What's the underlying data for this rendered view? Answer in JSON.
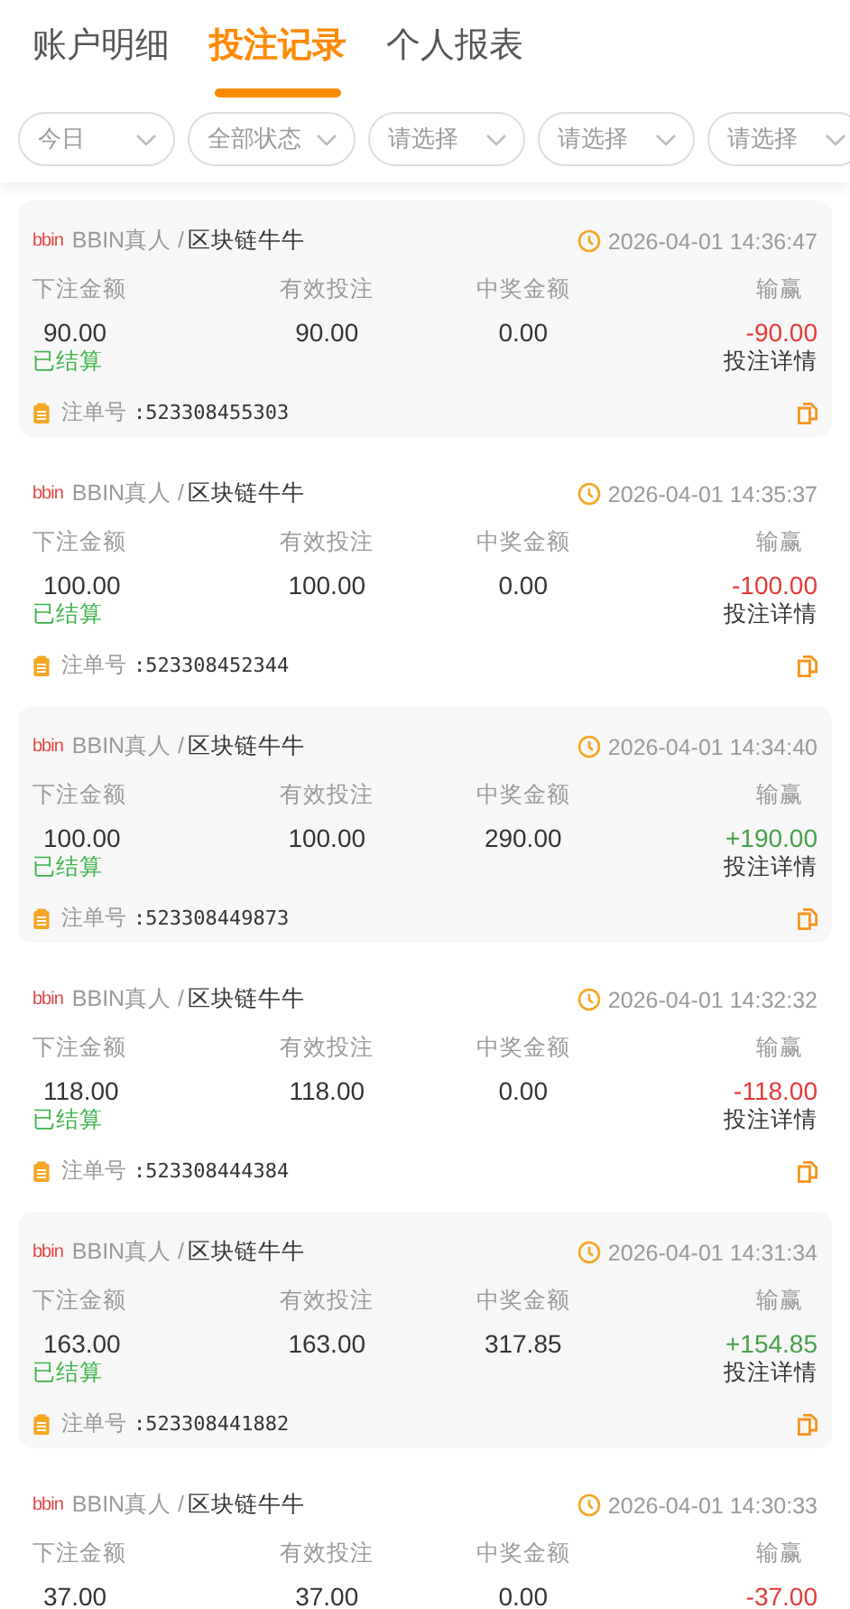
{
  "tabs": [
    {
      "label": "账户明细",
      "selected": false
    },
    {
      "label": "投注记录",
      "selected": true
    },
    {
      "label": "个人报表",
      "selected": false
    }
  ],
  "filters": [
    {
      "label": "今日"
    },
    {
      "label": "全部状态"
    },
    {
      "label": "请选择"
    },
    {
      "label": "请选择"
    },
    {
      "label": "请选择"
    }
  ],
  "records": [
    {
      "logo": "bbin",
      "platform": "BBIN真人 /",
      "game": "区块链牛牛",
      "time": "2026-04-01 14:36:47",
      "labels": [
        "下注金额",
        "有效投注",
        "中奖金额",
        "输赢"
      ],
      "values": [
        "90.00",
        "90.00",
        "0.00",
        "-90.00"
      ],
      "color": "#e53935",
      "status": "已结算",
      "detail_link": "投注详情",
      "order_label": "注单号",
      "order_no": ":523308455303"
    },
    {
      "logo": "bbin",
      "platform": "BBIN真人 /",
      "game": "区块链牛牛",
      "time": "2026-04-01 14:35:37",
      "labels": [
        "下注金额",
        "有效投注",
        "中奖金额",
        "输赢"
      ],
      "values": [
        "100.00",
        "100.00",
        "0.00",
        "-100.00"
      ],
      "color": "#e53935",
      "status": "已结算",
      "detail_link": "投注详情",
      "order_label": "注单号",
      "order_no": ":523308452344"
    },
    {
      "logo": "bbin",
      "platform": "BBIN真人 /",
      "game": "区块链牛牛",
      "time": "2026-04-01 14:34:40",
      "labels": [
        "下注金额",
        "有效投注",
        "中奖金额",
        "输赢"
      ],
      "values": [
        "100.00",
        "100.00",
        "290.00",
        "+190.00"
      ],
      "color": "#43a047",
      "status": "已结算",
      "detail_link": "投注详情",
      "order_label": "注单号",
      "order_no": ":523308449873"
    },
    {
      "logo": "bbin",
      "platform": "BBIN真人 /",
      "game": "区块链牛牛",
      "time": "2026-04-01 14:32:32",
      "labels": [
        "下注金额",
        "有效投注",
        "中奖金额",
        "输赢"
      ],
      "values": [
        "118.00",
        "118.00",
        "0.00",
        "-118.00"
      ],
      "color": "#e53935",
      "status": "已结算",
      "detail_link": "投注详情",
      "order_label": "注单号",
      "order_no": ":523308444384"
    },
    {
      "logo": "bbin",
      "platform": "BBIN真人 /",
      "game": "区块链牛牛",
      "time": "2026-04-01 14:31:34",
      "labels": [
        "下注金额",
        "有效投注",
        "中奖金额",
        "输赢"
      ],
      "values": [
        "163.00",
        "163.00",
        "317.85",
        "+154.85"
      ],
      "color": "#43a047",
      "status": "已结算",
      "detail_link": "投注详情",
      "order_label": "注单号",
      "order_no": ":523308441882"
    },
    {
      "logo": "bbin",
      "platform": "BBIN真人 /",
      "game": "区块链牛牛",
      "time": "2026-04-01 14:30:33",
      "labels": [
        "下注金额",
        "有效投注",
        "中奖金额",
        "输赢"
      ],
      "values": [
        "37.00",
        "37.00",
        "0.00",
        "-37.00"
      ],
      "color": "#e53935"
    }
  ]
}
